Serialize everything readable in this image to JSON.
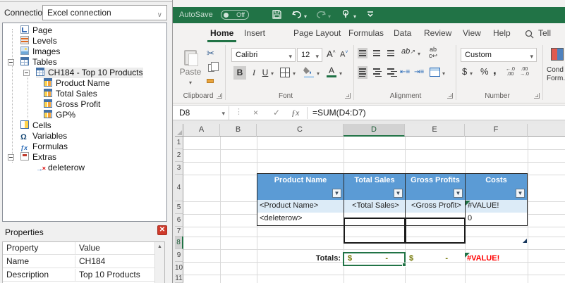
{
  "left_panel": {
    "connection_label": "Connection",
    "connection_value": "Excel connection",
    "tree": [
      {
        "label": "Page",
        "icon": "page-icon",
        "level": 1
      },
      {
        "label": "Levels",
        "icon": "levels-icon",
        "level": 1
      },
      {
        "label": "Images",
        "icon": "images-icon",
        "level": 1
      },
      {
        "label": "Tables",
        "icon": "table-icon",
        "level": 1,
        "expanded": true
      },
      {
        "label": "CH184 - Top 10 Products",
        "icon": "table-icon",
        "level": 2,
        "expanded": true,
        "selected": true
      },
      {
        "label": "Product Name",
        "icon": "field-icon",
        "level": 3
      },
      {
        "label": "Total Sales",
        "icon": "field-icon",
        "level": 3
      },
      {
        "label": "Gross Profit",
        "icon": "field-icon",
        "level": 3
      },
      {
        "label": "GP%",
        "icon": "field-icon",
        "level": 3
      },
      {
        "label": "Cells",
        "icon": "cells-icon",
        "level": 1
      },
      {
        "label": "Variables",
        "icon": "omega-icon",
        "level": 1
      },
      {
        "label": "Formulas",
        "icon": "fx-icon",
        "level": 1
      },
      {
        "label": "Extras",
        "icon": "extras-icon",
        "level": 1,
        "expanded": true
      },
      {
        "label": "deleterow",
        "icon": "deleterow-icon",
        "level": 2
      }
    ],
    "properties": {
      "title": "Properties",
      "columns": [
        "Property",
        "Value"
      ],
      "rows": [
        [
          "Name",
          "CH184"
        ],
        [
          "Description",
          "Top 10 Products"
        ]
      ]
    }
  },
  "excel": {
    "titlebar": {
      "autosave_label": "AutoSave",
      "autosave_state": "Off"
    },
    "tabs": [
      "Home",
      "Insert",
      "Page Layout",
      "Formulas",
      "Data",
      "Review",
      "View",
      "Help"
    ],
    "active_tab": "Home",
    "search_label": "Tell",
    "ribbon": {
      "clipboard": {
        "label": "Clipboard",
        "paste": "Paste"
      },
      "font": {
        "label": "Font",
        "font_name": "Calibri",
        "font_size": "12"
      },
      "alignment": {
        "label": "Alignment"
      },
      "number": {
        "label": "Number",
        "format": "Custom"
      },
      "cond_format": {
        "line1": "Cond",
        "line2": "Form."
      }
    },
    "formula_bar": {
      "name_box": "D8",
      "formula": "=SUM(D4:D7)"
    },
    "sheet": {
      "columns": [
        "A",
        "B",
        "C",
        "D",
        "E",
        "F"
      ],
      "rows": [
        "1",
        "2",
        "3",
        "4",
        "5",
        "6",
        "7",
        "8",
        "9",
        "10",
        "11"
      ],
      "selected_cell": "D8",
      "table": {
        "headers": [
          "Product Name",
          "Total Sales",
          "Gross Profits",
          "Costs"
        ],
        "row5": [
          "<Product Name>",
          "<Total Sales>",
          "<Gross Profit>",
          "#VALUE!"
        ],
        "row6": [
          "<deleterow>",
          "",
          "",
          "0"
        ]
      },
      "totals": {
        "label": "Totals:",
        "d8_currency": "$",
        "d8_value": "-",
        "e8_currency": "$",
        "e8_value": "-",
        "f8_error": "#VALUE!"
      }
    },
    "colors": {
      "excel_green": "#217346",
      "table_header_blue": "#5b9bd5",
      "banded_row_blue": "#dcebf7",
      "error_red": "#ff0000",
      "accounting_olive": "#6f7400"
    }
  }
}
